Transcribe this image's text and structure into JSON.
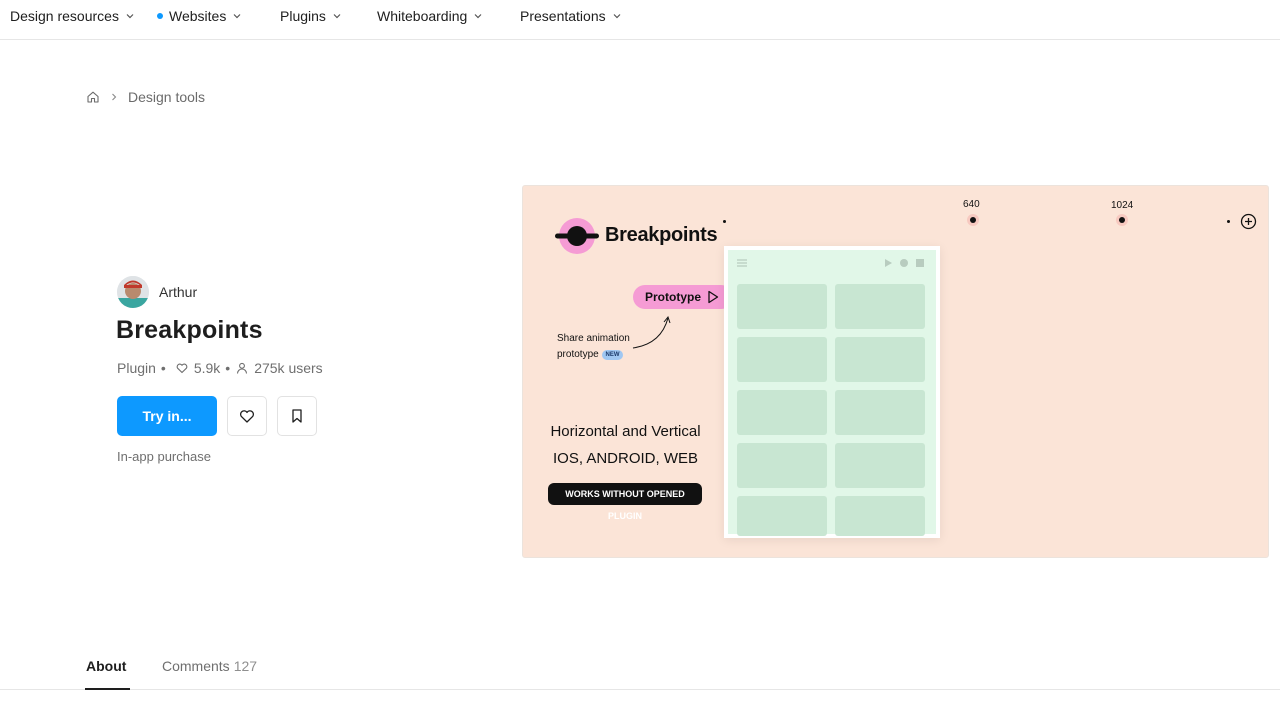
{
  "nav": {
    "items": [
      {
        "label": "Design resources"
      },
      {
        "label": "Websites"
      },
      {
        "label": "Plugins"
      },
      {
        "label": "Whiteboarding"
      },
      {
        "label": "Presentations"
      }
    ]
  },
  "breadcrumb": {
    "current": "Design tools"
  },
  "author": {
    "name": "Arthur"
  },
  "plugin": {
    "title": "Breakpoints",
    "type": "Plugin",
    "likes": "5.9k",
    "users": "275k users",
    "try_label": "Try in...",
    "purchase_note": "In-app purchase"
  },
  "hero": {
    "brand": "Breakpoints",
    "prototype_label": "Prototype",
    "share_line1": "Share animation",
    "share_line2": "prototype",
    "new_badge": "NEW",
    "line1": "Horizontal and Vertical",
    "line2": "IOS, ANDROID, WEB",
    "pill": "WORKS WITHOUT OPENED PLUGIN",
    "bp1": "640",
    "bp2": "1024"
  },
  "tabs": {
    "about": "About",
    "comments": "Comments",
    "comments_count": "127"
  },
  "colors": {
    "accent": "#0d99ff",
    "hero_bg": "#fbe4d7",
    "hero_pink": "#f59bd4",
    "hero_green": "#d3f0dd"
  }
}
